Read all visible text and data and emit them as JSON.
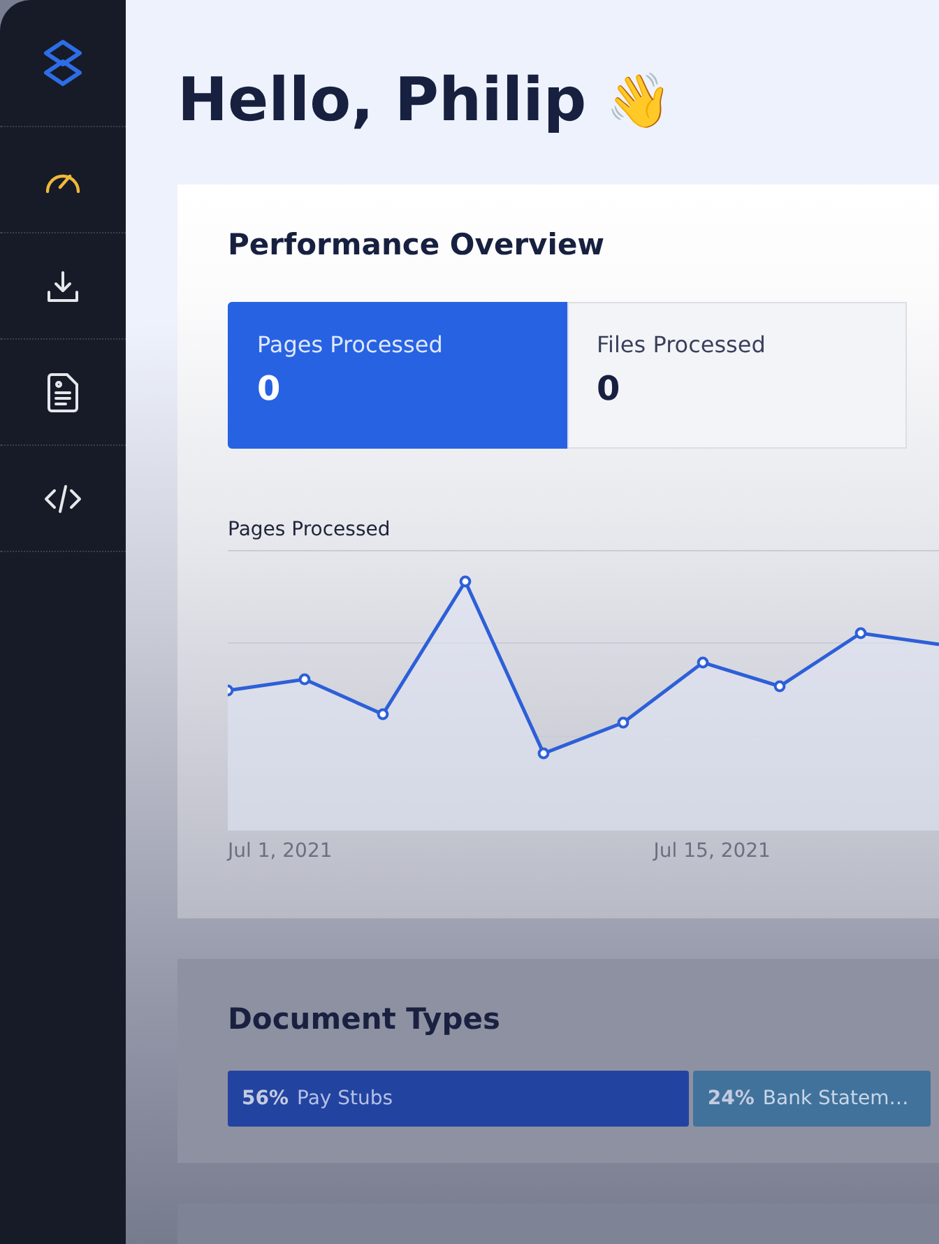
{
  "sidebar": {
    "items": [
      {
        "kind": "logo",
        "selected": false
      },
      {
        "kind": "gauge",
        "selected": true
      },
      {
        "kind": "download",
        "selected": false
      },
      {
        "kind": "document",
        "selected": false
      },
      {
        "kind": "code",
        "selected": false
      }
    ]
  },
  "greeting": {
    "title": "Hello, Philip",
    "emoji": "👋"
  },
  "performance": {
    "title": "Performance Overview",
    "stats": [
      {
        "label": "Pages Processed",
        "value": "0",
        "selected": true
      },
      {
        "label": "Files Processed",
        "value": "0",
        "selected": false
      }
    ],
    "chart": {
      "title": "Pages Processed",
      "x_labels": [
        "Jul 1, 2021",
        "Jul 15, 2021"
      ]
    }
  },
  "document_types": {
    "title": "Document Types",
    "segments": [
      {
        "percent": "56%",
        "label": "Pay Stubs",
        "color": "#2343a0"
      },
      {
        "percent": "24%",
        "label": "Bank Statem…",
        "color": "#41729c"
      }
    ]
  }
}
